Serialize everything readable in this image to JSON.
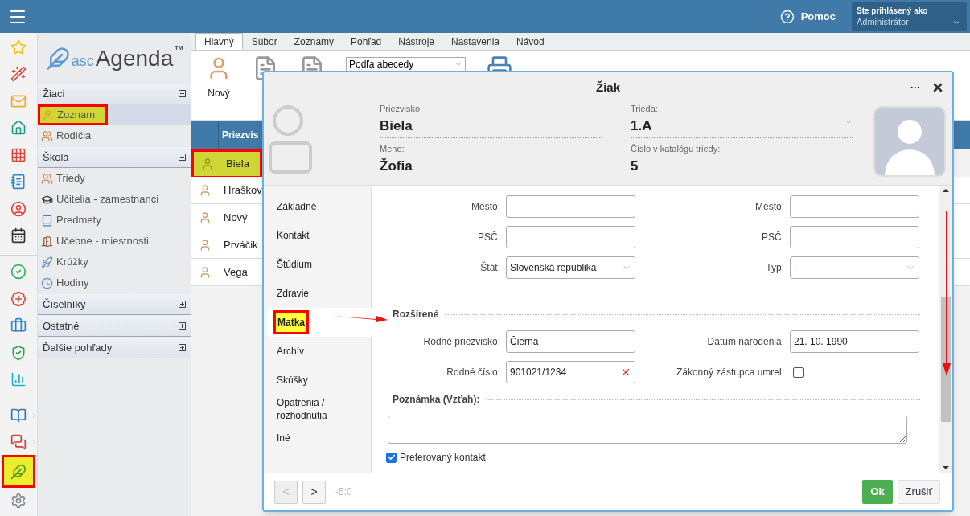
{
  "header": {
    "help": "Pomoc",
    "user_label": "Ste prihlásený ako",
    "user": "Administrátor"
  },
  "rail": [
    {
      "annotated": false
    },
    {
      "annotated": false
    },
    {
      "annotated": false
    },
    {
      "annotated": false
    },
    {
      "annotated": false
    },
    {
      "annotated": false
    },
    {
      "annotated": false
    },
    {
      "annotated": false
    },
    {
      "annotated": false
    },
    {
      "annotated": false
    },
    {
      "annotated": false
    },
    {
      "annotated": false
    },
    {
      "annotated": false
    },
    {
      "annotated": false
    },
    {
      "annotated": false
    },
    {
      "annotated": true
    },
    {
      "annotated": false
    }
  ],
  "logo": {
    "prefix": "asc",
    "name": "Agenda",
    "mark": "TM"
  },
  "nav": [
    {
      "title": "Žiaci",
      "expanded": true,
      "items": [
        {
          "label": "Zoznam",
          "selected": true,
          "annotated": true
        },
        {
          "label": "Rodičia",
          "selected": false,
          "annotated": false
        }
      ]
    },
    {
      "title": "Škola",
      "expanded": true,
      "items": [
        {
          "label": "Triedy",
          "selected": false,
          "annotated": false
        },
        {
          "label": "Učitelia - zamestnanci",
          "selected": false,
          "annotated": false
        },
        {
          "label": "Predmety",
          "selected": false,
          "annotated": false
        },
        {
          "label": "Učebne - miestnosti",
          "selected": false,
          "annotated": false
        },
        {
          "label": "Krúžky",
          "selected": false,
          "annotated": false
        },
        {
          "label": "Hodiny",
          "selected": false,
          "annotated": false
        }
      ]
    },
    {
      "title": "Číselníky",
      "expanded": false
    },
    {
      "title": "Ostatné",
      "expanded": false
    },
    {
      "title": "Ďalšie pohľady",
      "expanded": false
    }
  ],
  "tabs": [
    {
      "label": "Hlavný",
      "selected": true
    },
    {
      "label": "Súbor",
      "selected": false
    },
    {
      "label": "Zoznamy",
      "selected": false
    },
    {
      "label": "Pohľad",
      "selected": false
    },
    {
      "label": "Nástroje",
      "selected": false
    },
    {
      "label": "Nastavenia",
      "selected": false
    },
    {
      "label": "Návod",
      "selected": false
    }
  ],
  "toolbar": {
    "new_label": "Nový",
    "sort": "Podľa abecedy"
  },
  "table": {
    "columns": [
      "Priezvis"
    ],
    "rows": [
      {
        "surname": "Biela",
        "selected": true,
        "annotated": true
      },
      {
        "surname": "Hraškov",
        "selected": false,
        "annotated": false
      },
      {
        "surname": "Nový",
        "selected": false,
        "annotated": false
      },
      {
        "surname": "Prváčik",
        "selected": false,
        "annotated": false
      },
      {
        "surname": "Vega",
        "selected": false,
        "annotated": false
      }
    ]
  },
  "dialog": {
    "title": "Žiak",
    "more": "···",
    "fields": [
      {
        "label": "Priezvisko:",
        "value": "Biela",
        "kind": "text"
      },
      {
        "label": "Trieda:",
        "value": "1.A",
        "kind": "select"
      },
      {
        "label": "Meno:",
        "value": "Žofia",
        "kind": "text"
      },
      {
        "label": "Číslo v katalógu triedy:",
        "value": "5",
        "kind": "text"
      }
    ],
    "tabs": [
      {
        "label": "Základné",
        "selected": false,
        "annotated": false
      },
      {
        "label": "Kontakt",
        "selected": false,
        "annotated": false
      },
      {
        "label": "Štúdium",
        "selected": false,
        "annotated": false
      },
      {
        "label": "Zdravie",
        "selected": false,
        "annotated": false
      },
      {
        "label": "Matka",
        "selected": true,
        "annotated": true
      },
      {
        "label": "Archív",
        "selected": false,
        "annotated": false
      },
      {
        "label": "Skúšky",
        "selected": false,
        "annotated": false
      },
      {
        "label": "Opatrenia / rozhodnutia",
        "selected": false,
        "annotated": false
      },
      {
        "label": "Iné",
        "selected": false,
        "annotated": false
      }
    ],
    "address_rows": [
      {
        "fields": [
          {
            "label": "Mesto:",
            "kind": "text"
          },
          {
            "label": "Mesto:",
            "kind": "text"
          }
        ]
      },
      {
        "fields": [
          {
            "label": "PSČ:",
            "kind": "text"
          },
          {
            "label": "PSČ:",
            "kind": "text"
          }
        ]
      },
      {
        "fields": [
          {
            "label": "Štát:",
            "kind": "select",
            "value": "Slovenská republika"
          },
          {
            "label": "Typ:",
            "kind": "select",
            "value": "-"
          }
        ]
      }
    ],
    "extended": {
      "title": "Rozšírené",
      "rows": [
        {
          "fields": [
            {
              "label": "Rodné priezvisko:",
              "kind": "text",
              "value": "Čierna"
            },
            {
              "label": "Dátum narodenia:",
              "kind": "text",
              "value": "21. 10. 1990"
            }
          ]
        },
        {
          "fields": [
            {
              "label": "Rodné číslo:",
              "kind": "clearable",
              "value": "901021/1234"
            },
            {
              "label": "Zákonný zástupca umrel:",
              "kind": "checkbox",
              "checked": false
            }
          ]
        }
      ]
    },
    "note": {
      "title": "Poznámka (Vzťah):"
    },
    "preferred": {
      "label": "Preferovaný kontakt",
      "checked": true
    },
    "footer": {
      "prev": "<",
      "prev_disabled": true,
      "next": ">",
      "counter": "-5:0",
      "ok": "Ok",
      "cancel": "Zrušiť"
    }
  }
}
